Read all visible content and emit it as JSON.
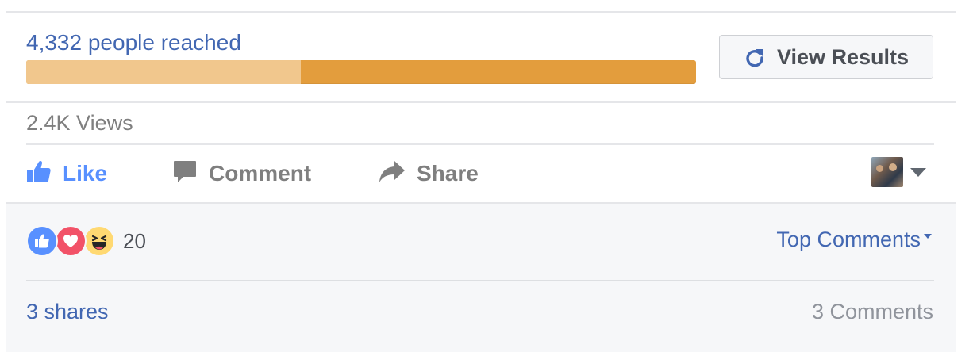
{
  "reach": {
    "label": "4,332 people reached",
    "progress_fraction": 0.41,
    "colors": {
      "filled": "#f1c78d",
      "remaining": "#e39d3d"
    }
  },
  "view_results": {
    "label": "View Results",
    "icon": "refresh-icon",
    "icon_color": "#4267b2"
  },
  "views": {
    "label": "2.4K Views"
  },
  "actions": [
    {
      "key": "like",
      "label": "Like",
      "icon": "thumbs-up-icon",
      "color": "#5890ff"
    },
    {
      "key": "comment",
      "label": "Comment",
      "icon": "comment-icon",
      "color": "#7f7f7f"
    },
    {
      "key": "share",
      "label": "Share",
      "icon": "share-arrow-icon",
      "color": "#7f7f7f"
    }
  ],
  "audience": {
    "avatar_icon": "profile-photo",
    "menu_icon": "chevron-down-icon"
  },
  "reactions": {
    "icons": [
      "like-reaction-icon",
      "love-reaction-icon",
      "haha-reaction-icon"
    ],
    "count": "20"
  },
  "comments_sort": {
    "label": "Top Comments"
  },
  "footer": {
    "shares": "3 shares",
    "comments": "3 Comments"
  }
}
